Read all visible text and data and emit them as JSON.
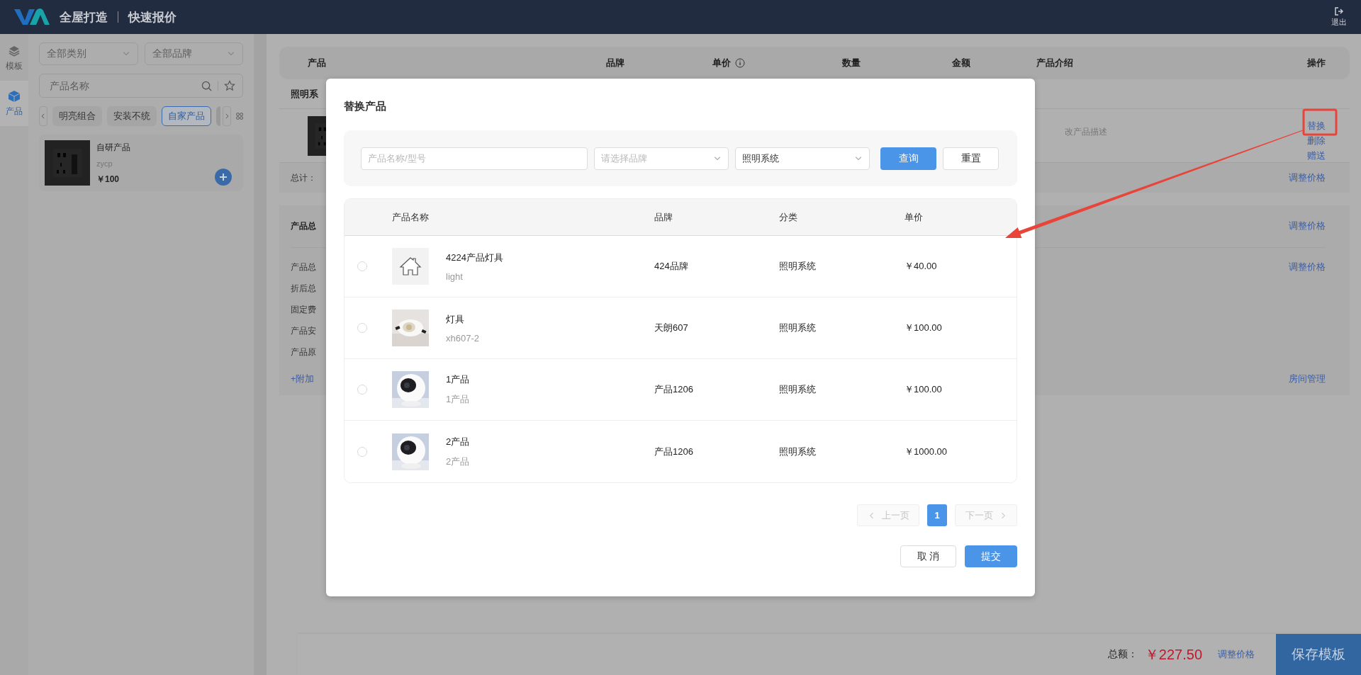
{
  "top_bar": {
    "title": "全屋打造",
    "subtitle": "快速报价",
    "logout": "退出"
  },
  "rail": [
    {
      "label": "模板",
      "selected": false
    },
    {
      "label": "产品",
      "selected": true
    }
  ],
  "catalog": {
    "category": "全部类别",
    "brand": "全部品牌",
    "search_placeholder": "产品名称",
    "tags": [
      {
        "label": "明亮组合",
        "selected": false
      },
      {
        "label": "安装不统",
        "selected": false
      },
      {
        "label": "自家产品",
        "selected": true
      }
    ],
    "products": [
      {
        "name": "自研产品",
        "code": "zycp",
        "price": "￥100"
      }
    ]
  },
  "quote": {
    "columns": [
      {
        "label": "产品",
        "info": false
      },
      {
        "label": "品牌",
        "info": false
      },
      {
        "label": "单价",
        "info": true
      },
      {
        "label": "数量",
        "info": false
      },
      {
        "label": "金额",
        "info": false
      },
      {
        "label": "产品介绍",
        "info": false
      },
      {
        "label": "操作",
        "info": false
      }
    ],
    "group": "照明系",
    "item": {
      "description": "改产品描述",
      "actions": [
        "替换",
        "删除",
        "赠送"
      ]
    },
    "subtotal": {
      "label": "总计：",
      "action": "调整价格"
    },
    "summary": {
      "title": "产品总",
      "title_action": "调整价格",
      "lines": [
        {
          "label": "产品总",
          "action": "调整价格"
        },
        {
          "label": "折后总"
        },
        {
          "label": "固定费"
        },
        {
          "label": "产品安"
        },
        {
          "label": "产品原"
        }
      ],
      "add_link": "+附加",
      "room_link": "房间管理"
    }
  },
  "footer": {
    "total_label": "总额：",
    "total": "￥227.50",
    "adjust": "调整价格",
    "save": "保存模板"
  },
  "dialog": {
    "title": "替换产品",
    "search_placeholder": "产品名称/型号",
    "brand_placeholder": "请选择品牌",
    "category": "照明系统",
    "query": "查询",
    "reset": "重置",
    "columns": [
      "产品名称",
      "品牌",
      "分类",
      "单价"
    ],
    "rows": [
      {
        "name": "4224产品灯具",
        "code": "light",
        "brand": "424品牌",
        "category": "照明系统",
        "price": "￥40.00",
        "kind": "placeholder",
        "selected": false
      },
      {
        "name": "灯具",
        "code": "xh607-2",
        "brand": "天朗607",
        "category": "照明系统",
        "price": "￥100.00",
        "kind": "downlight",
        "selected": false
      },
      {
        "name": "1产品",
        "code": "1产品",
        "brand": "产品1206",
        "category": "照明系统",
        "price": "￥100.00",
        "kind": "camera",
        "selected": false
      },
      {
        "name": "2产品",
        "code": "2产品",
        "brand": "产品1206",
        "category": "照明系统",
        "price": "￥1000.00",
        "kind": "camera",
        "selected": false
      }
    ],
    "pagination": {
      "prev": "上一页",
      "next": "下一页",
      "prev_disabled": true,
      "next_disabled": true,
      "pages": [
        {
          "label": "1",
          "selected": true
        }
      ]
    },
    "cancel": "取 消",
    "submit": "提交"
  }
}
